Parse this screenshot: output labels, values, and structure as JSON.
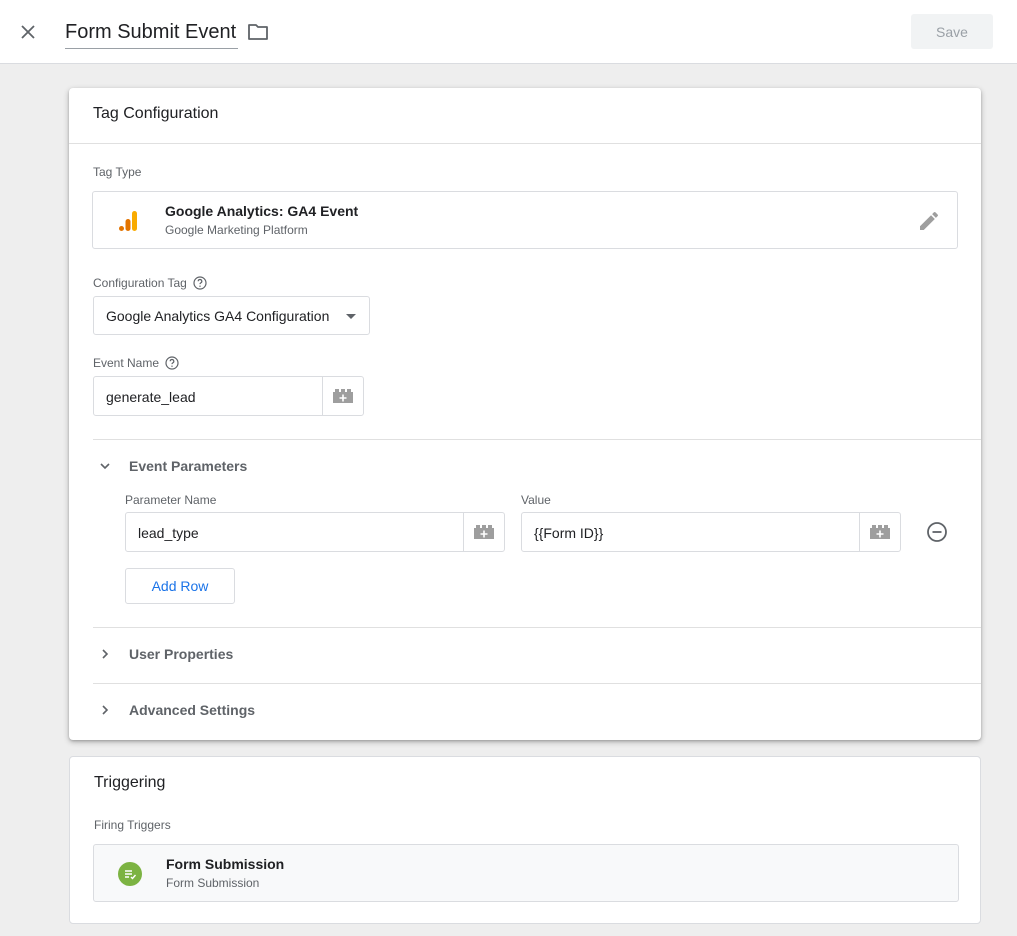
{
  "header": {
    "title": "Form Submit Event",
    "save_label": "Save"
  },
  "tag_config": {
    "title": "Tag Configuration",
    "tag_type_label": "Tag Type",
    "tag_type_name": "Google Analytics: GA4 Event",
    "tag_type_platform": "Google Marketing Platform",
    "config_tag_label": "Configuration Tag",
    "config_tag_value": "Google Analytics GA4 Configuration",
    "event_name_label": "Event Name",
    "event_name_value": "generate_lead",
    "event_params": {
      "title": "Event Parameters",
      "param_name_label": "Parameter Name",
      "value_label": "Value",
      "rows": [
        {
          "name": "lead_type",
          "value": "{{Form ID}}"
        }
      ],
      "add_row_label": "Add Row"
    },
    "user_properties_label": "User Properties",
    "advanced_settings_label": "Advanced Settings"
  },
  "triggering": {
    "title": "Triggering",
    "firing_label": "Firing Triggers",
    "trigger_name": "Form Submission",
    "trigger_type": "Form Submission"
  },
  "colors": {
    "accent": "#1a73e8",
    "ga_orange": "#f9ab00",
    "ga_dark_orange": "#e37400",
    "trigger_green": "#7cb342"
  }
}
